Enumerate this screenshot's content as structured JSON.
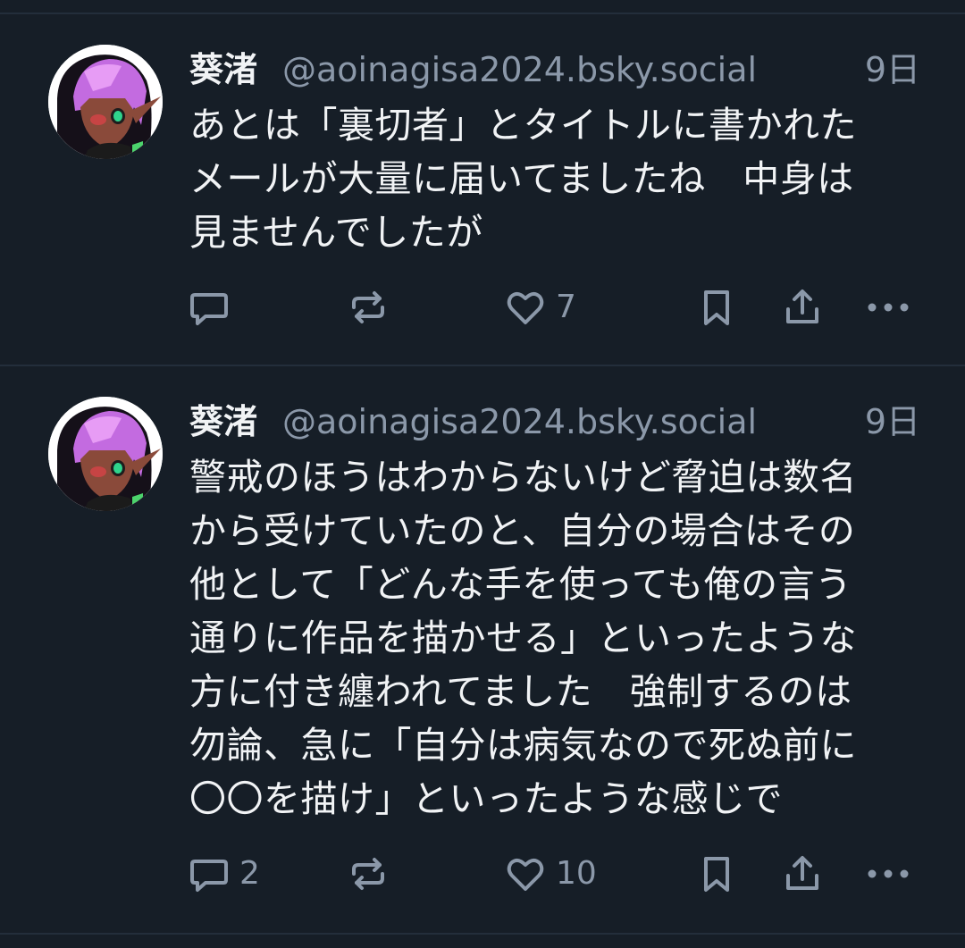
{
  "posts": [
    {
      "author": {
        "display_name": "葵渚",
        "handle": "@aoinagisa2024.bsky.social"
      },
      "time": "9日",
      "lines": [
        "あとは「裏切者」とタイトルに書かれた",
        "メールが大量に届いてましたね　中身は",
        "見ませんでしたが"
      ],
      "actions": {
        "reply_count": "",
        "repost_count": "",
        "like_count": "7"
      }
    },
    {
      "author": {
        "display_name": "葵渚",
        "handle": "@aoinagisa2024.bsky.social"
      },
      "time": "9日",
      "lines": [
        "警戒のほうはわからないけど脅迫は数名",
        "から受けていたのと、自分の場合はその",
        "他として「どんな手を使っても俺の言う",
        "通りに作品を描かせる」といったような",
        "方に付き纏われてました　強制するのは",
        "勿論、急に「自分は病気なので死ぬ前に",
        "〇〇を描け」といったような感じで"
      ],
      "actions": {
        "reply_count": "2",
        "repost_count": "",
        "like_count": "10"
      }
    }
  ],
  "icons": {
    "reply": "speech-bubble-icon",
    "repost": "repost-arrows-icon",
    "like": "heart-icon",
    "bookmark": "bookmark-icon",
    "share": "share-upload-icon",
    "more": "ellipsis-icon"
  },
  "colors": {
    "background": "#161e27",
    "divider": "#232e3b",
    "primary_text": "#f1f3f5",
    "secondary_text": "#8b98a9"
  }
}
